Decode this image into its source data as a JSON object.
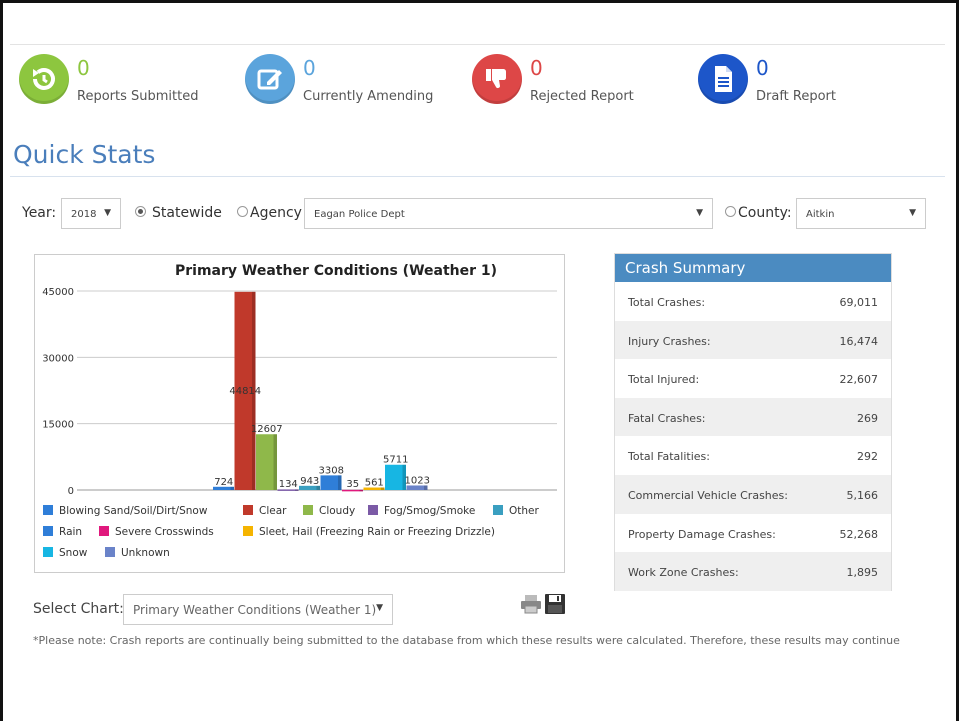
{
  "status_counters": [
    {
      "count": "0",
      "label": "Reports Submitted",
      "color": "#8dc63f",
      "icon": "refresh-icon"
    },
    {
      "count": "0",
      "label": "Currently Amending",
      "color": "#5ba4dc",
      "icon": "edit-icon"
    },
    {
      "count": "0",
      "label": "Rejected Report",
      "color": "#dd4747",
      "icon": "thumbs-down-icon"
    },
    {
      "count": "0",
      "label": "Draft Report",
      "color": "#1d56c9",
      "icon": "document-icon"
    }
  ],
  "quick_stats": {
    "title": "Quick Stats"
  },
  "filters": {
    "year_label": "Year:",
    "year_value": "2018",
    "statewide_label": "Statewide",
    "agency_label": "Agency",
    "agency_value": "Eagan Police Dept",
    "county_label": "County:",
    "county_value": "Aitkin",
    "selected_scope": "Statewide"
  },
  "chart_data": {
    "type": "bar",
    "title": "Primary Weather Conditions (Weather 1)",
    "xlabel": "",
    "ylabel": "",
    "ylim": [
      0,
      45000
    ],
    "yticks": [
      "45000",
      "30000",
      "15000",
      "0"
    ],
    "grid": true,
    "legend_position": "bottom",
    "series": [
      {
        "name": "Blowing Sand/Soil/Dirt/Snow",
        "value": 724,
        "label": "724",
        "color": "#2f7ed8"
      },
      {
        "name": "Clear",
        "value": 44814,
        "label": "44814",
        "color": "#c0392b"
      },
      {
        "name": "Cloudy",
        "value": 12607,
        "label": "12607",
        "color": "#8fb84a"
      },
      {
        "name": "Fog/Smog/Smoke",
        "value": 134,
        "label": "134",
        "color": "#7b5aa6"
      },
      {
        "name": "Other",
        "value": 943,
        "label": "943",
        "color": "#3a9fc0"
      },
      {
        "name": "Rain",
        "value": 3308,
        "label": "3308",
        "color": "#2f7ed8"
      },
      {
        "name": "Severe Crosswinds",
        "value": 35,
        "label": "35",
        "color": "#e0197d"
      },
      {
        "name": "Sleet, Hail (Freezing Rain or Freezing Drizzle)",
        "value": 561,
        "label": "561",
        "color": "#f5b400"
      },
      {
        "name": "Snow",
        "value": 5711,
        "label": "5711",
        "color": "#17b6e3"
      },
      {
        "name": "Unknown",
        "value": 1023,
        "label": "1023",
        "color": "#6a83c9"
      }
    ]
  },
  "select_chart": {
    "label": "Select Chart:",
    "value": "Primary Weather Conditions (Weather 1)"
  },
  "note": "*Please note: Crash reports are continually being submitted to the database from which these results were calculated. Therefore, these results may continue",
  "crash_summary": {
    "title": "Crash Summary",
    "rows": [
      {
        "label": "Total Crashes:",
        "value": "69,011"
      },
      {
        "label": "Injury Crashes:",
        "value": "16,474"
      },
      {
        "label": "Total Injured:",
        "value": "22,607"
      },
      {
        "label": "Fatal Crashes:",
        "value": "269"
      },
      {
        "label": "Total Fatalities:",
        "value": "292"
      },
      {
        "label": "Commercial Vehicle Crashes:",
        "value": "5,166"
      },
      {
        "label": "Property Damage Crashes:",
        "value": "52,268"
      },
      {
        "label": "Work Zone Crashes:",
        "value": "1,895"
      }
    ]
  }
}
